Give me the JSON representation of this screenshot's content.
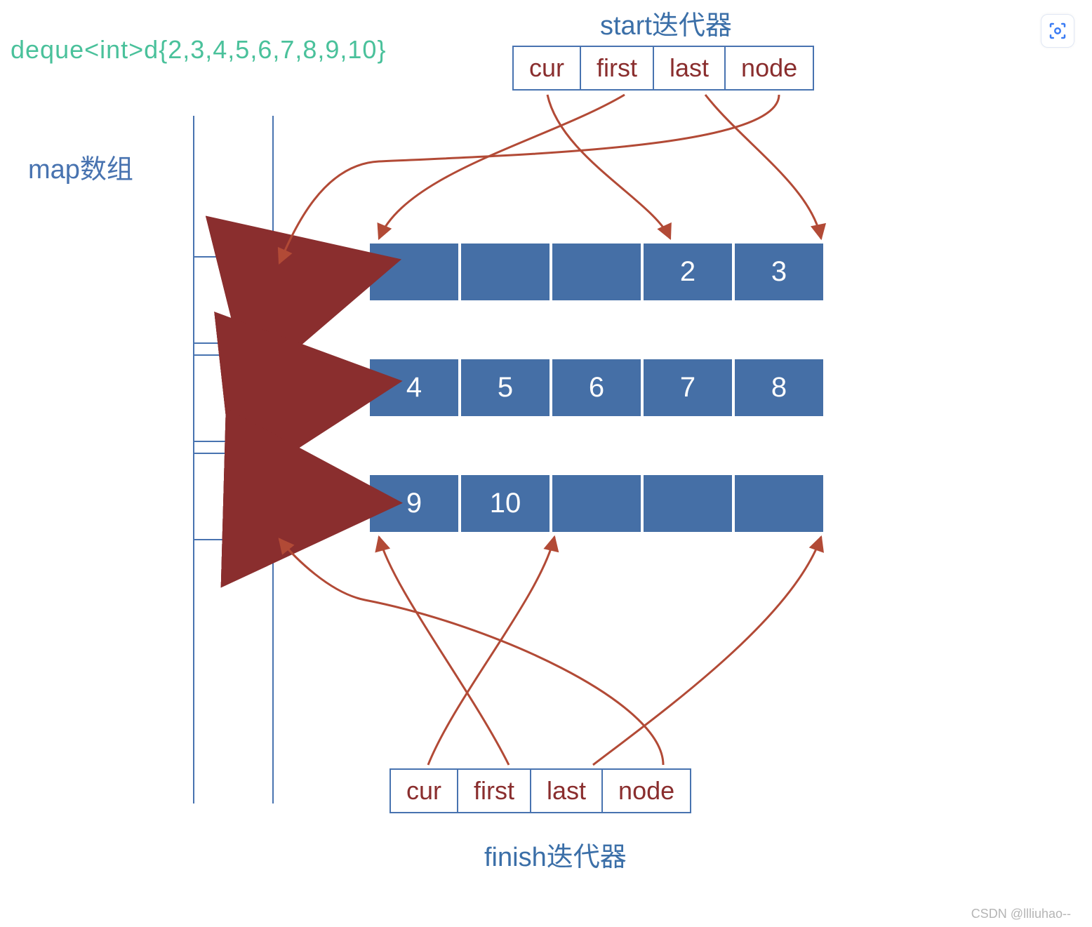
{
  "declaration": "deque<int>d{2,3,4,5,6,7,8,9,10}",
  "start_iterator": {
    "title": "start迭代器",
    "fields": [
      "cur",
      "first",
      "last",
      "node"
    ]
  },
  "finish_iterator": {
    "title": "finish迭代器",
    "fields": [
      "cur",
      "first",
      "last",
      "node"
    ]
  },
  "map_label": "map数组",
  "buffers": [
    {
      "cells": [
        "",
        "",
        "",
        "2",
        "3"
      ]
    },
    {
      "cells": [
        "4",
        "5",
        "6",
        "7",
        "8"
      ]
    },
    {
      "cells": [
        "9",
        "10",
        "",
        "",
        ""
      ]
    }
  ],
  "watermark": "CSDN @llliuhao--"
}
